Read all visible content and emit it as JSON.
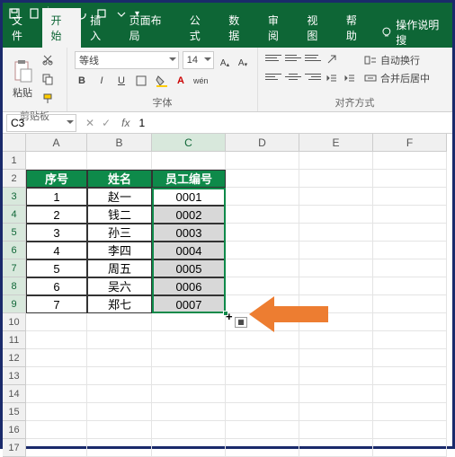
{
  "titlebar": {
    "qat_down": "▾"
  },
  "tabs": {
    "file": "文件",
    "home": "开始",
    "insert": "插入",
    "layout": "页面布局",
    "formulas": "公式",
    "data": "数据",
    "review": "审阅",
    "view": "视图",
    "help": "帮助",
    "tell_me": "操作说明搜"
  },
  "ribbon": {
    "paste": "粘贴",
    "clipboard_label": "剪贴板",
    "font_name": "等线",
    "font_size": "14",
    "bold": "B",
    "italic": "I",
    "underline": "U",
    "wen": "wén",
    "font_label": "字体",
    "wrap_text": "自动换行",
    "merge_center": "合并后居中",
    "align_label": "对齐方式"
  },
  "namebox": {
    "ref": "C3",
    "cancel": "✕",
    "confirm": "✓",
    "fx": "fx",
    "formula": "1"
  },
  "columns": [
    "A",
    "B",
    "C",
    "D",
    "E",
    "F"
  ],
  "chart_data": {
    "type": "table",
    "headers": [
      "序号",
      "姓名",
      "员工编号"
    ],
    "rows": [
      {
        "序号": "1",
        "姓名": "赵一",
        "员工编号": "0001"
      },
      {
        "序号": "2",
        "姓名": "钱二",
        "员工编号": "0002"
      },
      {
        "序号": "3",
        "姓名": "孙三",
        "员工编号": "0003"
      },
      {
        "序号": "4",
        "姓名": "李四",
        "员工编号": "0004"
      },
      {
        "序号": "5",
        "姓名": "周五",
        "员工编号": "0005"
      },
      {
        "序号": "6",
        "姓名": "吴六",
        "员工编号": "0006"
      },
      {
        "序号": "7",
        "姓名": "郑七",
        "员工编号": "0007"
      }
    ]
  },
  "selection": {
    "active": "C3",
    "range": "C3:C9"
  }
}
